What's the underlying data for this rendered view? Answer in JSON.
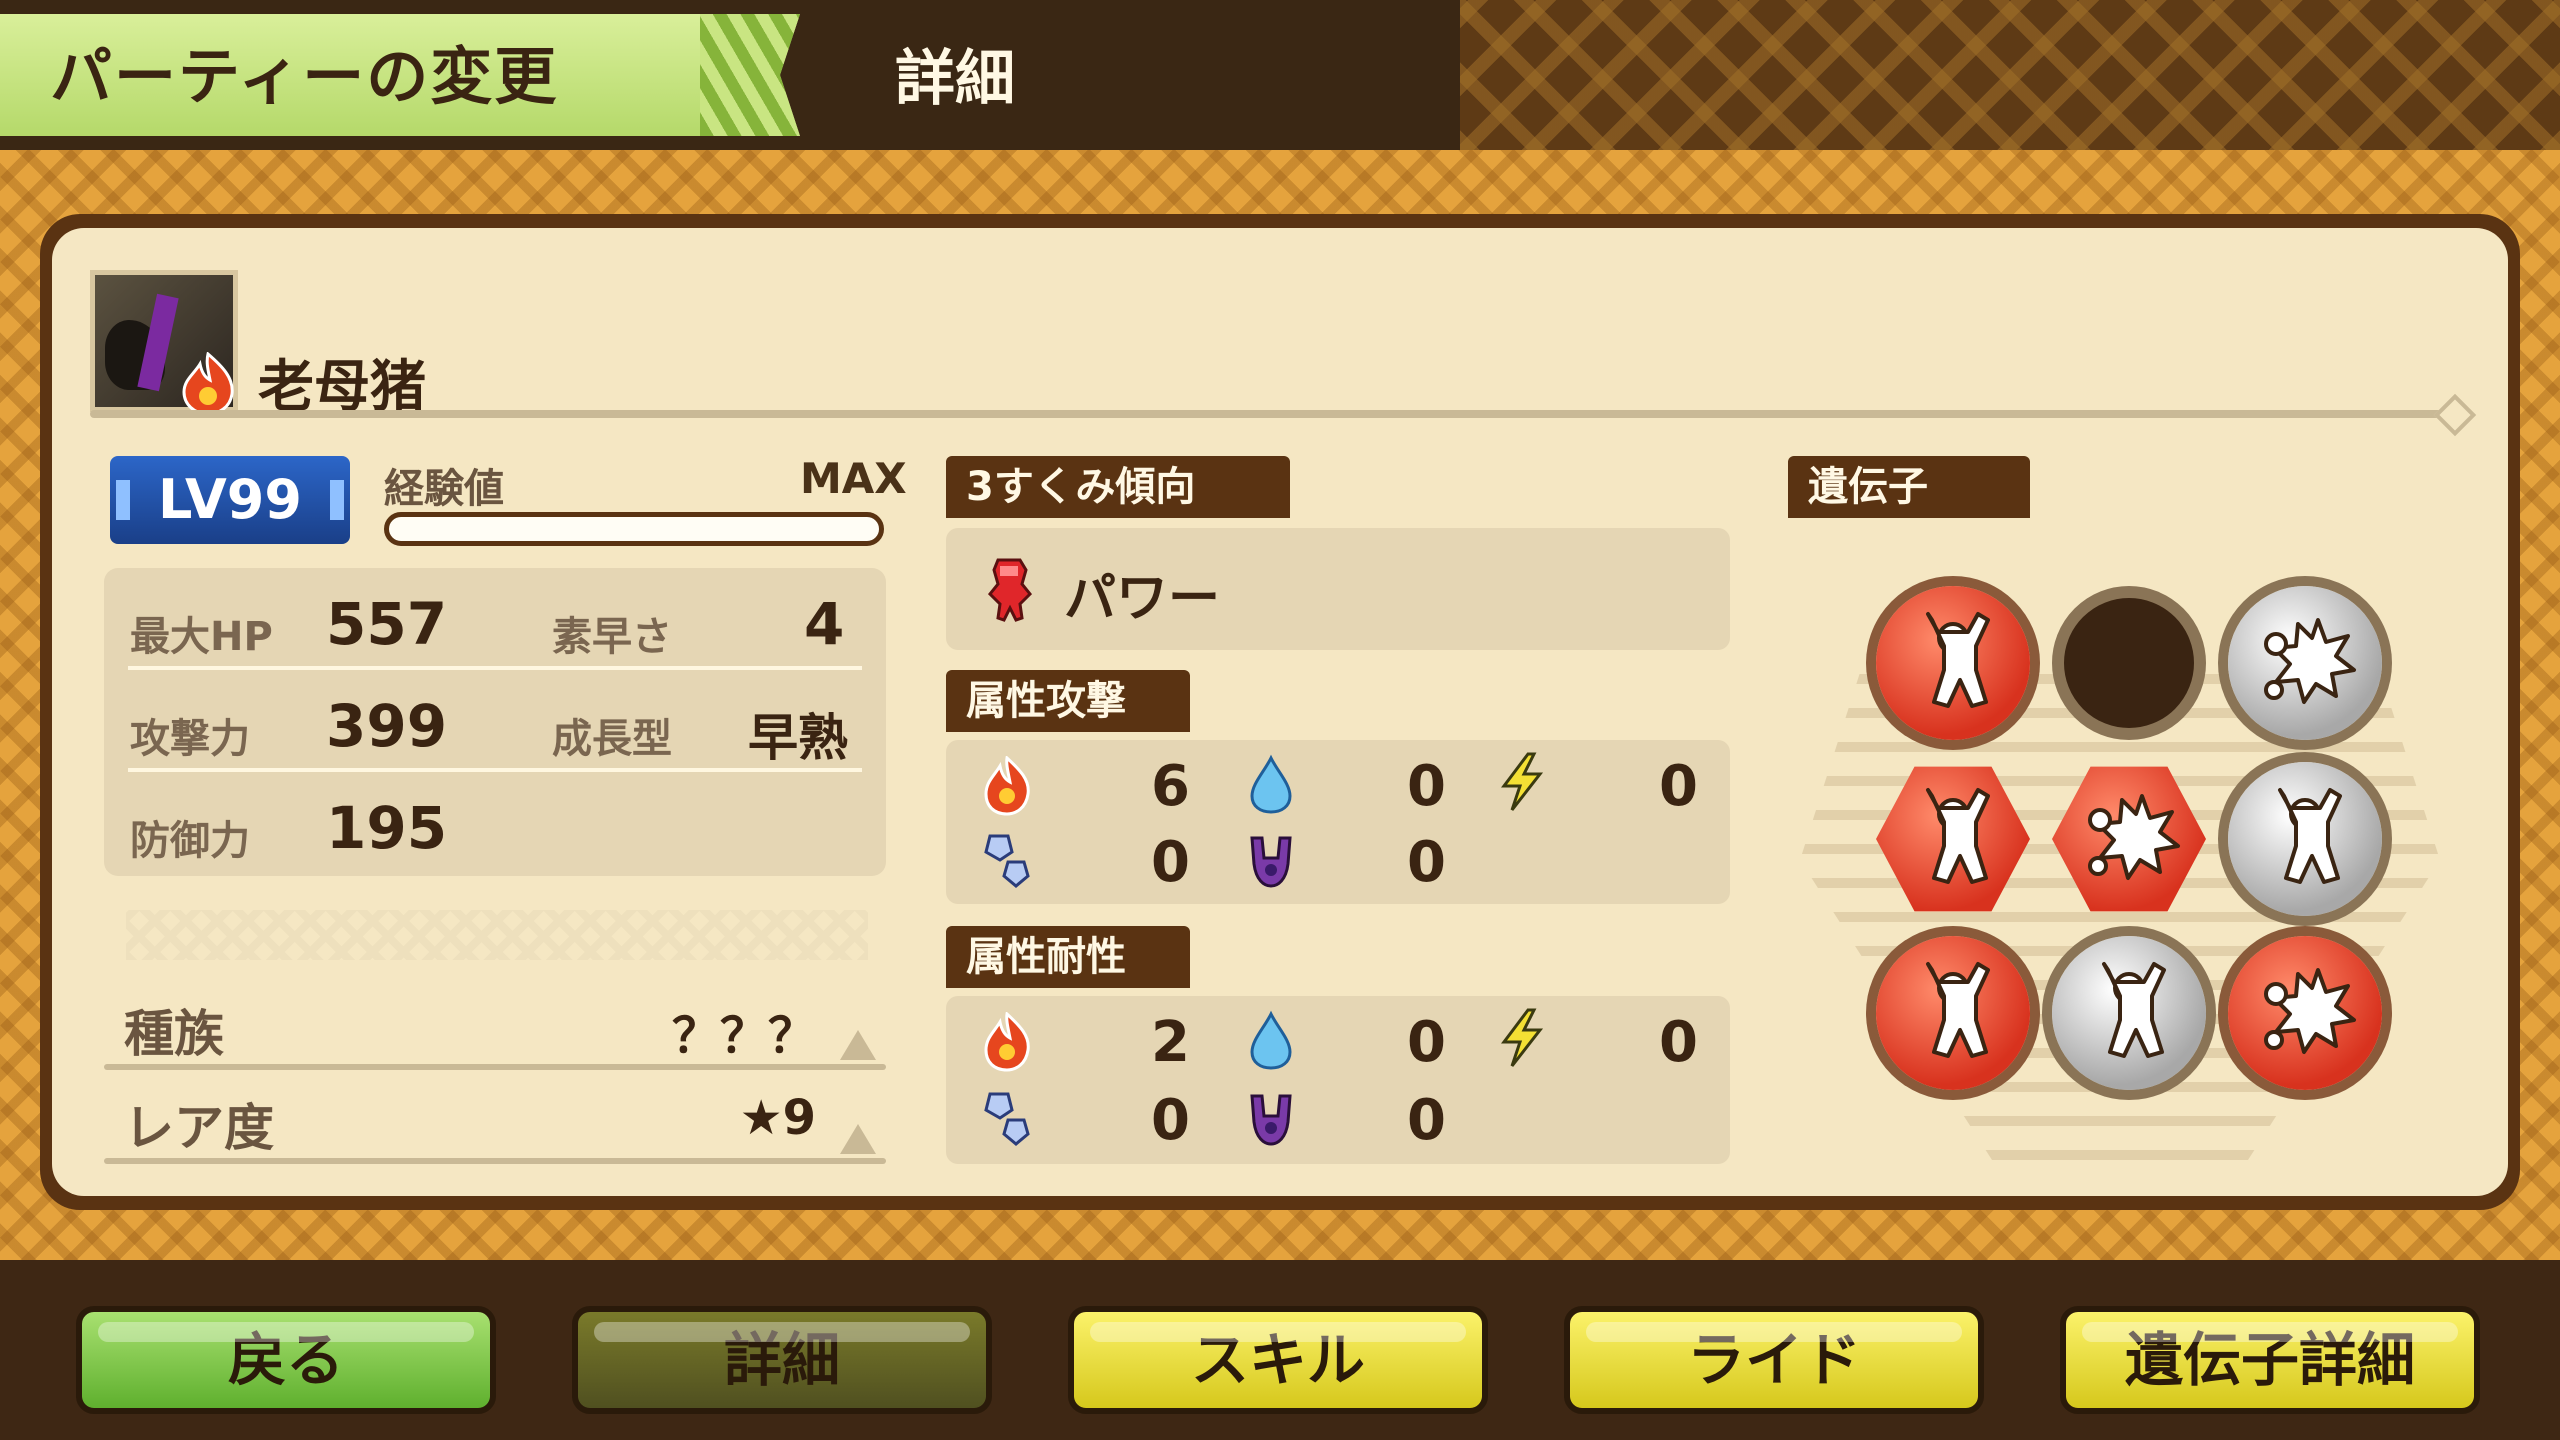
{
  "header": {
    "title": "パーティーの変更",
    "subtitle": "詳細"
  },
  "monster": {
    "name": "老母猪",
    "element_icon": "fire-icon"
  },
  "level": {
    "label": "LV99",
    "exp_label": "経験値",
    "exp_status": "MAX",
    "exp_fill": 1.0
  },
  "stats": {
    "max_hp_label": "最大HP",
    "max_hp": "557",
    "speed_label": "素早さ",
    "speed": "4",
    "attack_label": "攻撃力",
    "attack": "399",
    "growth_label": "成長型",
    "growth": "早熟",
    "defense_label": "防御力",
    "defense": "195"
  },
  "info": {
    "species_label": "種族",
    "species": "？？？",
    "rarity_label": "レア度",
    "rarity": "★9"
  },
  "tendency": {
    "section_label": "3すくみ傾向",
    "value": "パワー",
    "icon": "power-fist-icon"
  },
  "attribute_attack": {
    "section_label": "属性攻撃",
    "fire": "6",
    "water": "0",
    "thunder": "0",
    "ice": "0",
    "dragon": "0"
  },
  "attribute_resist": {
    "section_label": "属性耐性",
    "fire": "2",
    "water": "0",
    "thunder": "0",
    "ice": "0",
    "dragon": "0"
  },
  "genes": {
    "section_label": "遺伝子",
    "slots": [
      {
        "shape": "circle",
        "color": "red",
        "icon": "power-icon"
      },
      {
        "shape": "empty",
        "color": "none",
        "icon": "none"
      },
      {
        "shape": "circle",
        "color": "silver",
        "icon": "burst-icon"
      },
      {
        "shape": "hex",
        "color": "red",
        "icon": "power-icon"
      },
      {
        "shape": "hex",
        "color": "red",
        "icon": "burst-icon"
      },
      {
        "shape": "circle",
        "color": "silver",
        "icon": "power-icon"
      },
      {
        "shape": "circle",
        "color": "red",
        "icon": "power-icon"
      },
      {
        "shape": "circle",
        "color": "silver",
        "icon": "power-icon"
      },
      {
        "shape": "circle",
        "color": "red",
        "icon": "burst-icon"
      }
    ]
  },
  "buttons": {
    "back": "戻る",
    "detail": "詳細",
    "skill": "スキル",
    "ride": "ライド",
    "gene_detail": "遺伝子詳細"
  },
  "colors": {
    "panel_bg": "#f5e7c3",
    "dark_brown": "#5a3312",
    "level_blue": "#2c66c8",
    "fire_red": "#e6461e",
    "gene_red": "#e04a3a",
    "gene_silver": "#c8c8c8",
    "button_green": "#7cc84a",
    "button_yellow": "#f0e23a"
  }
}
